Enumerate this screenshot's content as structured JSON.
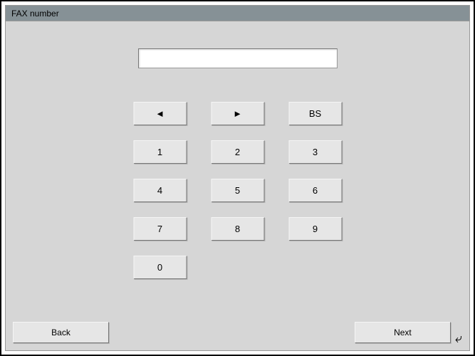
{
  "title": "FAX number",
  "input": {
    "value": "",
    "placeholder": ""
  },
  "keypad": {
    "left_arrow": "◄",
    "right_arrow": "►",
    "backspace": "BS",
    "n1": "1",
    "n2": "2",
    "n3": "3",
    "n4": "4",
    "n5": "5",
    "n6": "6",
    "n7": "7",
    "n8": "8",
    "n9": "9",
    "n0": "0"
  },
  "footer": {
    "back": "Back",
    "next": "Next",
    "enter_glyph": "⤶"
  }
}
